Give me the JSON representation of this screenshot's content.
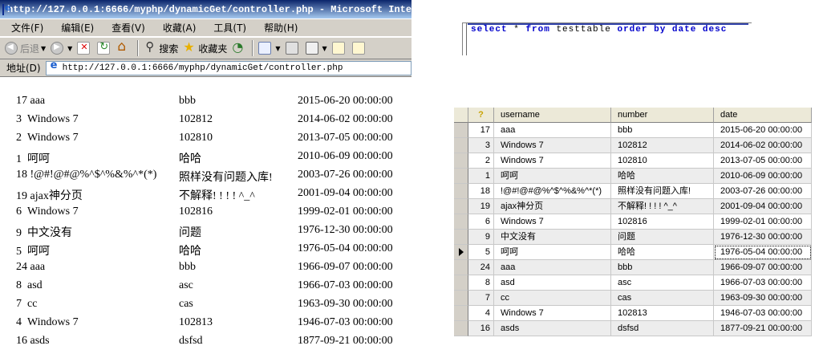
{
  "browser": {
    "title": "http://127.0.0.1:6666/myphp/dynamicGet/controller.php - Microsoft Inte",
    "menu": [
      "文件(F)",
      "编辑(E)",
      "查看(V)",
      "收藏(A)",
      "工具(T)",
      "帮助(H)"
    ],
    "toolbar": {
      "back_label": "后退",
      "search_label": "搜索",
      "favorites_label": "收藏夹"
    },
    "address_label": "地址(D)",
    "address_url": "http://127.0.0.1:6666/myphp/dynamicGet/controller.php"
  },
  "page_rows": [
    {
      "num": "17",
      "username": "aaa",
      "number": "bbb",
      "date": "2015-06-20 00:00:00"
    },
    {
      "num": "3",
      "username": "Windows 7",
      "number": "102812",
      "date": "2014-06-02 00:00:00"
    },
    {
      "num": "2",
      "username": "Windows 7",
      "number": "102810",
      "date": "2013-07-05 00:00:00"
    },
    {
      "num": "1",
      "username": "呵呵",
      "number": "哈哈",
      "date": "2010-06-09 00:00:00"
    },
    {
      "num": "18",
      "username": "!@#!@#@%^$^%&%^*(*)",
      "number": "照样没有问题入库!",
      "date": "2003-07-26 00:00:00"
    },
    {
      "num": "19",
      "username": "ajax神分页",
      "number": "不解释! ! ! ! ^_^",
      "date": "2001-09-04 00:00:00"
    },
    {
      "num": "6",
      "username": "Windows 7",
      "number": "102816",
      "date": "1999-02-01 00:00:00"
    },
    {
      "num": "9",
      "username": "中文没有",
      "number": "问题",
      "date": "1976-12-30 00:00:00"
    },
    {
      "num": "5",
      "username": "呵呵",
      "number": "哈哈",
      "date": "1976-05-04 00:00:00"
    },
    {
      "num": "24",
      "username": "aaa",
      "number": "bbb",
      "date": "1966-09-07 00:00:00"
    },
    {
      "num": "8",
      "username": "asd",
      "number": "asc",
      "date": "1966-07-03 00:00:00"
    },
    {
      "num": "7",
      "username": "cc",
      "number": "cas",
      "date": "1963-09-30 00:00:00"
    },
    {
      "num": "4",
      "username": "Windows 7",
      "number": "102813",
      "date": "1946-07-03 00:00:00"
    },
    {
      "num": "16",
      "username": "asds",
      "number": "dsfsd",
      "date": "1877-09-21 00:00:00"
    }
  ],
  "sql": {
    "kw_select": "select",
    "star": "*",
    "kw_from": "from",
    "table": "testtable",
    "kw_order_by": "order by",
    "column": "date",
    "kw_desc": "desc"
  },
  "grid": {
    "columns": [
      "username",
      "number",
      "date"
    ],
    "selected_row": 8,
    "rows": [
      {
        "num": "17",
        "username": "aaa",
        "number": "bbb",
        "date": "2015-06-20 00:00:00"
      },
      {
        "num": "3",
        "username": "Windows 7",
        "number": "102812",
        "date": "2014-06-02 00:00:00"
      },
      {
        "num": "2",
        "username": "Windows 7",
        "number": "102810",
        "date": "2013-07-05 00:00:00"
      },
      {
        "num": "1",
        "username": "呵呵",
        "number": "哈哈",
        "date": "2010-06-09 00:00:00"
      },
      {
        "num": "18",
        "username": "!@#!@#@%^$^%&%^*(*)",
        "number": "照样没有问题入库!",
        "date": "2003-07-26 00:00:00"
      },
      {
        "num": "19",
        "username": "ajax神分页",
        "number": "不解释! ! ! ! ^_^",
        "date": "2001-09-04 00:00:00"
      },
      {
        "num": "6",
        "username": "Windows 7",
        "number": "102816",
        "date": "1999-02-01 00:00:00"
      },
      {
        "num": "9",
        "username": "中文没有",
        "number": "问题",
        "date": "1976-12-30 00:00:00"
      },
      {
        "num": "5",
        "username": "呵呵",
        "number": "哈哈",
        "date": "1976-05-04 00:00:00"
      },
      {
        "num": "24",
        "username": "aaa",
        "number": "bbb",
        "date": "1966-09-07 00:00:00"
      },
      {
        "num": "8",
        "username": "asd",
        "number": "asc",
        "date": "1966-07-03 00:00:00"
      },
      {
        "num": "7",
        "username": "cc",
        "number": "cas",
        "date": "1963-09-30 00:00:00"
      },
      {
        "num": "4",
        "username": "Windows 7",
        "number": "102813",
        "date": "1946-07-03 00:00:00"
      },
      {
        "num": "16",
        "username": "asds",
        "number": "dsfsd",
        "date": "1877-09-21 00:00:00"
      }
    ]
  }
}
